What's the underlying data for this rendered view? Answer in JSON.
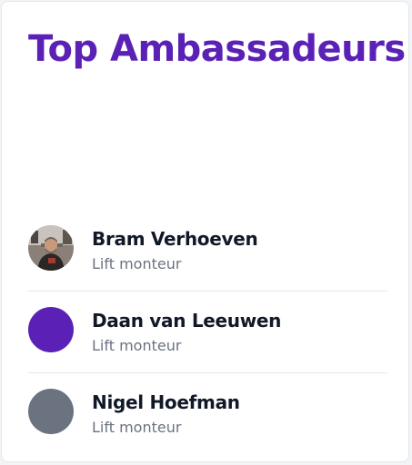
{
  "card": {
    "title": "Top Ambassadeurs"
  },
  "ambassadors": [
    {
      "name": "Bram Verhoeven",
      "role": "Lift monteur",
      "avatar": "photo"
    },
    {
      "name": "Daan van Leeuwen",
      "role": "Lift monteur",
      "avatar": "solid",
      "avatar_color": "#5b21b6"
    },
    {
      "name": "Nigel Hoefman",
      "role": "Lift monteur",
      "avatar": "solid",
      "avatar_color": "#6b7280"
    }
  ],
  "colors": {
    "title": "#5b21b6",
    "name": "#111827",
    "role": "#6b7280",
    "divider": "#e5e7eb"
  }
}
